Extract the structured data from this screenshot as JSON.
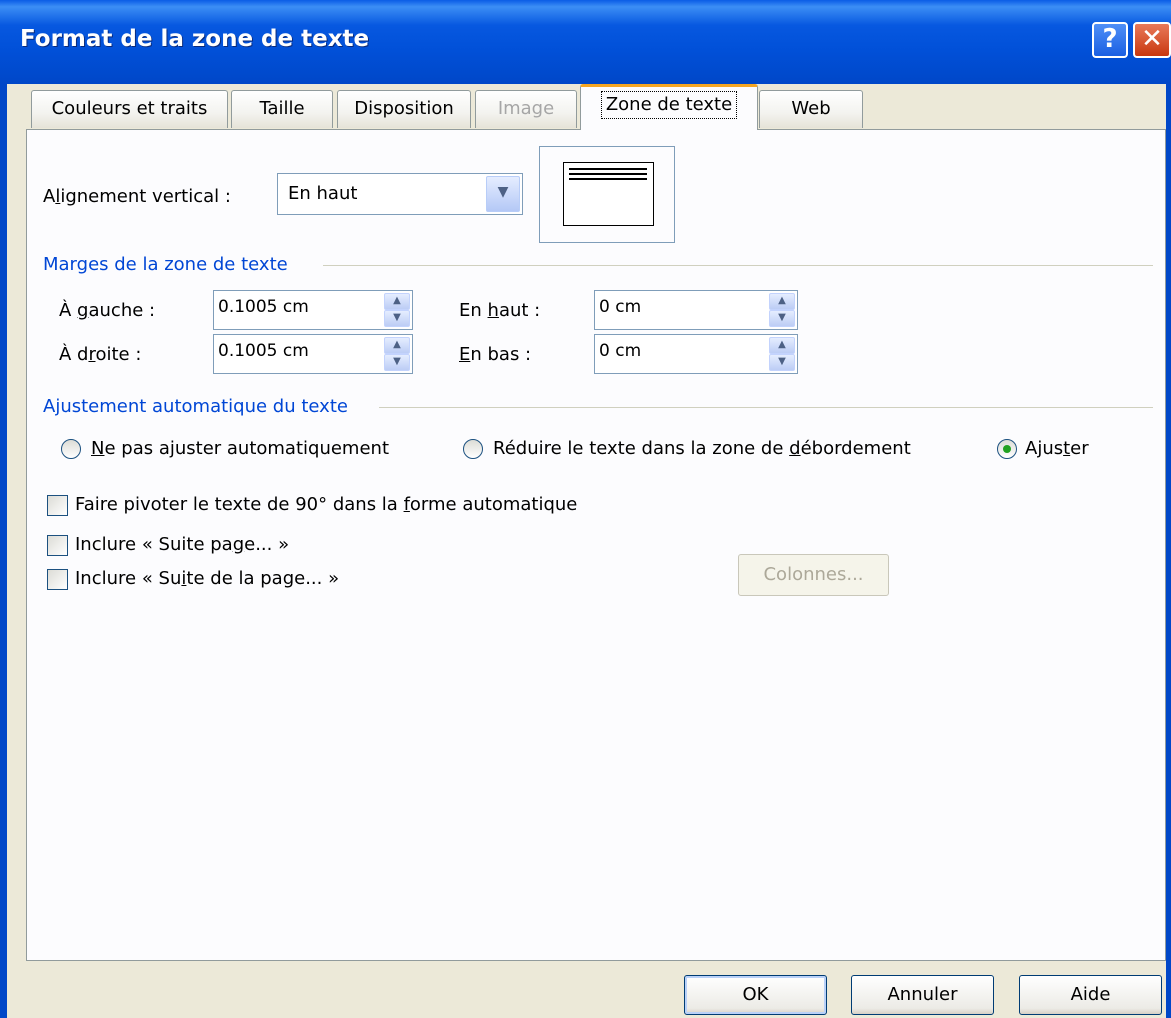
{
  "window": {
    "title": "Format de la zone de texte",
    "help_glyph": "?",
    "close_glyph": "✕"
  },
  "tabs": [
    {
      "label": "Couleurs et traits",
      "state": "normal"
    },
    {
      "label": "Taille",
      "state": "normal"
    },
    {
      "label": "Disposition",
      "state": "normal"
    },
    {
      "label": "Image",
      "state": "disabled"
    },
    {
      "label": "Zone de texte",
      "state": "active"
    },
    {
      "label": "Web",
      "state": "normal"
    }
  ],
  "vertical_alignment": {
    "label_pre": "A",
    "label_mnemonic": "l",
    "label_post": "ignement vertical :",
    "value": "En haut"
  },
  "margins": {
    "title": "Marges de la zone de texte",
    "left": {
      "pre": "À ",
      "m": "g",
      "post": "auche :",
      "value": "0.1005 cm"
    },
    "right": {
      "pre": "À d",
      "m": "r",
      "post": "oite :",
      "value": "0.1005 cm"
    },
    "top": {
      "pre": "En ",
      "m": "h",
      "post": "aut :",
      "value": "0 cm"
    },
    "bottom": {
      "pre": "",
      "m": "E",
      "post": "n bas :",
      "value": "0 cm"
    }
  },
  "autofit": {
    "title": "Ajustement automatique du texte",
    "option1": {
      "pre": "",
      "m": "N",
      "post": "e pas ajuster automatiquement",
      "selected": false
    },
    "option2": {
      "pre": "Réduire le texte dans la zone de ",
      "m": "d",
      "post": "ébordement",
      "selected": false
    },
    "option3": {
      "pre": "Ajus",
      "m": "t",
      "post": "er",
      "selected": true
    }
  },
  "checkboxes": {
    "rotate": {
      "pre": "Faire pivoter le texte de 90° dans la ",
      "m": "f",
      "post": "orme automatique",
      "checked": false
    },
    "continued_on": {
      "pre": "Inclure « Suite pa",
      "m": "g",
      "post": "e... »",
      "checked": false
    },
    "continued_from": {
      "pre": "Inclure « Su",
      "m": "i",
      "post": "te de la page... »",
      "checked": false
    }
  },
  "columns_button": "Colonnes...",
  "footer": {
    "ok": "OK",
    "cancel": "Annuler",
    "help": "Aide"
  },
  "colors": {
    "title_bar": "#0047c8",
    "group_title": "#0046d5",
    "active_tab_accent": "#f5a623",
    "radio_dot": "#21a121"
  }
}
